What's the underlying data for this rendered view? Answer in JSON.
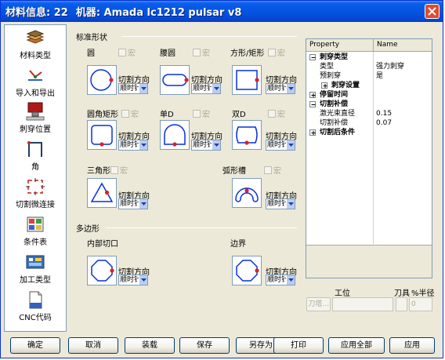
{
  "window": {
    "title_left": "材料信息: 22",
    "title_right": "机器: Amada lc1212 pulsar v8"
  },
  "sidebar": {
    "items": [
      {
        "label": "材料类型",
        "icon": "material-layers-icon"
      },
      {
        "label": "导入和导出",
        "icon": "import-export-icon"
      },
      {
        "label": "刺穿位置",
        "icon": "pierce-position-icon"
      },
      {
        "label": "角",
        "icon": "corner-icon"
      },
      {
        "label": "切割微连接",
        "icon": "micro-joint-icon"
      },
      {
        "label": "条件表",
        "icon": "condition-table-icon"
      },
      {
        "label": "加工类型",
        "icon": "process-type-icon"
      },
      {
        "label": "CNC代码",
        "icon": "cnc-code-icon"
      }
    ]
  },
  "main": {
    "standard_group": "标准形状",
    "polygon_group": "多边形",
    "macro_label": "宏",
    "cut_direction_label": "切割方向",
    "direction_value": "顺时针",
    "shapes": [
      {
        "label": "圆",
        "icon": "circle-shape-icon"
      },
      {
        "label": "腰圆",
        "icon": "obround-shape-icon"
      },
      {
        "label": "方形/矩形",
        "icon": "rectangle-shape-icon"
      },
      {
        "label": "圆角矩形",
        "icon": "rounded-rectangle-shape-icon"
      },
      {
        "label": "单D",
        "icon": "single-d-shape-icon"
      },
      {
        "label": "双D",
        "icon": "double-d-shape-icon"
      },
      {
        "label": "三角形",
        "icon": "triangle-shape-icon"
      },
      {
        "label": "弧形槽",
        "icon": "arc-slot-shape-icon"
      }
    ],
    "polygons": [
      {
        "label": "内部切口",
        "icon": "inner-cut-polygon-icon"
      },
      {
        "label": "边界",
        "icon": "border-polygon-icon"
      }
    ]
  },
  "properties": {
    "header": {
      "property": "Property",
      "name": "Name"
    },
    "rows": [
      {
        "key": "刺穿类型",
        "value": "",
        "kind": "category",
        "expander": "minus"
      },
      {
        "key": "类型",
        "value": "强力刺穿",
        "kind": "item"
      },
      {
        "key": "预刺穿",
        "value": "是",
        "kind": "item"
      },
      {
        "key": "刺穿设置",
        "value": "",
        "kind": "subcategory",
        "expander": "plus"
      },
      {
        "key": "停留时间",
        "value": "",
        "kind": "category",
        "expander": "plus"
      },
      {
        "key": "切割补偿",
        "value": "",
        "kind": "category",
        "expander": "minus"
      },
      {
        "key": "激光束直径",
        "value": "0.15",
        "kind": "item"
      },
      {
        "key": "切割补偿",
        "value": "0.07",
        "kind": "item"
      },
      {
        "key": "切割后条件",
        "value": "",
        "kind": "category",
        "expander": "plus"
      }
    ]
  },
  "tool": {
    "station_label": "工位",
    "tool_label": "刀具",
    "radius_label": "%半径",
    "button_label": "刀塔...",
    "radius_value": "0"
  },
  "buttons": [
    "确定",
    "取消",
    "装载",
    "保存",
    "另存为",
    "打印",
    "应用全部",
    "应用"
  ],
  "colors": {
    "titlebar": "#0554E3",
    "face": "#ECE9D8",
    "shape_stroke": "#0831D9",
    "pierce_point": "#E02020"
  }
}
